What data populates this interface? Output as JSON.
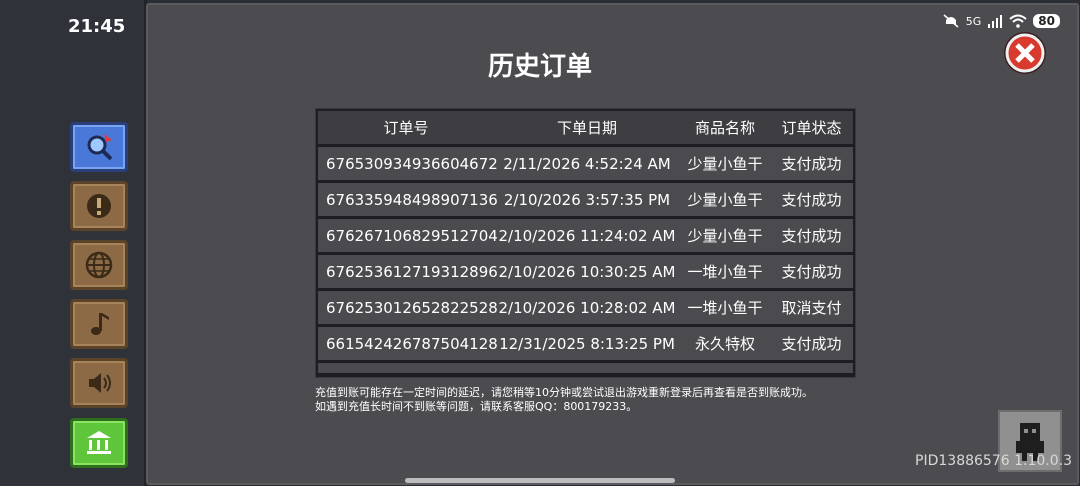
{
  "status_bar": {
    "time": "21:45",
    "network": "5G",
    "battery": "80"
  },
  "sidebar": {
    "buttons": [
      {
        "icon": "search-icon"
      },
      {
        "icon": "info-icon"
      },
      {
        "icon": "globe-icon"
      },
      {
        "icon": "music-note-icon"
      },
      {
        "icon": "speaker-icon"
      },
      {
        "icon": "bank-icon"
      }
    ]
  },
  "dialog": {
    "title": "历史订单",
    "close_icon": "close-icon",
    "columns": [
      "订单号",
      "下单日期",
      "商品名称",
      "订单状态"
    ],
    "orders": [
      {
        "id": "676530934936604672",
        "date": "2/11/2026 4:52:24 AM",
        "product": "少量小鱼干",
        "status": "支付成功"
      },
      {
        "id": "676335948498907136",
        "date": "2/10/2026 3:57:35 PM",
        "product": "少量小鱼干",
        "status": "支付成功"
      },
      {
        "id": "676267106829512704",
        "date": "2/10/2026 11:24:02 AM",
        "product": "少量小鱼干",
        "status": "支付成功"
      },
      {
        "id": "676253612719312896",
        "date": "2/10/2026 10:30:25 AM",
        "product": "一堆小鱼干",
        "status": "支付成功"
      },
      {
        "id": "676253012652822528",
        "date": "2/10/2026 10:28:02 AM",
        "product": "一堆小鱼干",
        "status": "取消支付"
      },
      {
        "id": "661542426787504128",
        "date": "12/31/2025 8:13:25 PM",
        "product": "永久特权",
        "status": "支付成功"
      }
    ],
    "note_line1": "充值到账可能存在一定时间的延迟，请您稍等10分钟或尝试退出游戏重新登录后再查看是否到账成功。",
    "note_line2": "如遇到充值长时间不到账等问题，请联系客服QQ：800179233。"
  },
  "footer": {
    "pid": "PID13886576 1.10.0.3",
    "robot_icon": "robot-icon"
  },
  "colors": {
    "panel": "#4c4c50",
    "table_bg": "#1e1e22",
    "close_red": "#d83a2e",
    "green_button": "#5fc53a",
    "blue_button": "#4a78d8"
  }
}
